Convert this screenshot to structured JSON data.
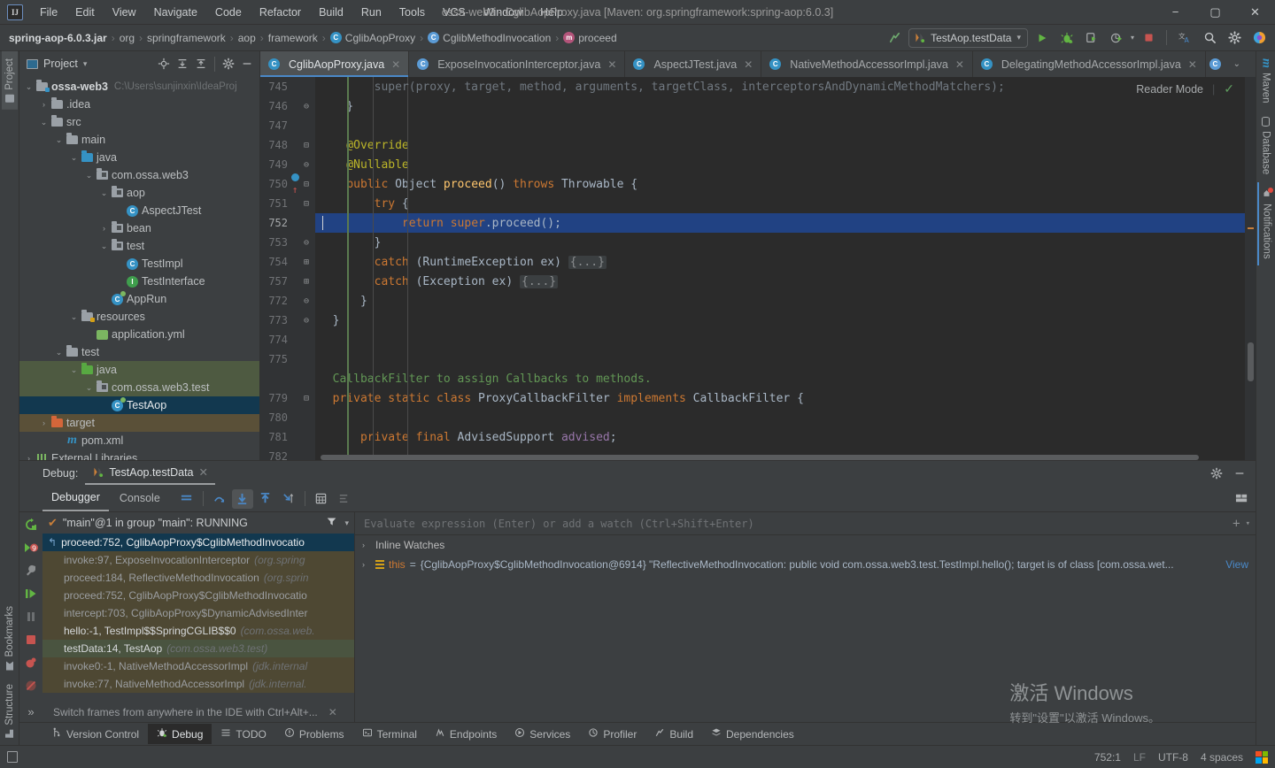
{
  "window": {
    "title": "ossa-web3 - CglibAopProxy.java [Maven: org.springframework:spring-aop:6.0.3]",
    "logo": "IJ",
    "minimize": "−",
    "maximize": "▢",
    "close": "✕"
  },
  "menubar": [
    "File",
    "Edit",
    "View",
    "Navigate",
    "Code",
    "Refactor",
    "Build",
    "Run",
    "Tools",
    "VCS",
    "Window",
    "Help"
  ],
  "breadcrumb": [
    {
      "label": "spring-aop-6.0.3.jar",
      "icon": "",
      "bold": true
    },
    {
      "label": "org",
      "icon": ""
    },
    {
      "label": "springframework",
      "icon": ""
    },
    {
      "label": "aop",
      "icon": ""
    },
    {
      "label": "framework",
      "icon": ""
    },
    {
      "label": "CglibAopProxy",
      "icon": "class-icon"
    },
    {
      "label": "CglibMethodInvocation",
      "icon": "class-icon"
    },
    {
      "label": "proceed",
      "icon": "method-icon"
    }
  ],
  "run_config": {
    "name": "TestAop.testData",
    "chevron": "▾"
  },
  "toolbar_icons": [
    "build-icon",
    "run-icon",
    "debug-icon",
    "run-with-coverage-icon",
    "profile-icon",
    "stop-icon",
    "translate-icon",
    "search-icon",
    "settings-icon",
    "ai-assistant-icon"
  ],
  "project_panel": {
    "title": "Project",
    "chevron": "▾",
    "actions": [
      "locate-icon",
      "expand-all-icon",
      "collapse-all-icon",
      "gear-icon",
      "hide-icon"
    ],
    "tree": [
      {
        "depth": 0,
        "twisty": "v",
        "icon": "module-folder",
        "label": "ossa-web3",
        "bold": true,
        "path": "C:\\Users\\sunjinxin\\IdeaProj",
        "state": ""
      },
      {
        "depth": 1,
        "twisty": ">",
        "icon": "folder",
        "label": ".idea",
        "state": ""
      },
      {
        "depth": 1,
        "twisty": "v",
        "icon": "folder",
        "label": "src",
        "state": ""
      },
      {
        "depth": 2,
        "twisty": "v",
        "icon": "folder",
        "label": "main",
        "state": ""
      },
      {
        "depth": 3,
        "twisty": "v",
        "icon": "folder-blue",
        "label": "java",
        "state": ""
      },
      {
        "depth": 4,
        "twisty": "v",
        "icon": "package",
        "label": "com.ossa.web3",
        "state": ""
      },
      {
        "depth": 5,
        "twisty": "v",
        "icon": "package",
        "label": "aop",
        "state": ""
      },
      {
        "depth": 6,
        "twisty": "",
        "icon": "class-c",
        "label": "AspectJTest",
        "state": ""
      },
      {
        "depth": 5,
        "twisty": ">",
        "icon": "package",
        "label": "bean",
        "state": ""
      },
      {
        "depth": 5,
        "twisty": "v",
        "icon": "package",
        "label": "test",
        "state": ""
      },
      {
        "depth": 6,
        "twisty": "",
        "icon": "class-c",
        "label": "TestImpl",
        "state": ""
      },
      {
        "depth": 6,
        "twisty": "",
        "icon": "interface-i",
        "label": "TestInterface",
        "state": ""
      },
      {
        "depth": 5,
        "twisty": "",
        "icon": "spring-class",
        "label": "AppRun",
        "state": ""
      },
      {
        "depth": 3,
        "twisty": "v",
        "icon": "folder-res",
        "label": "resources",
        "state": ""
      },
      {
        "depth": 4,
        "twisty": "",
        "icon": "yml",
        "label": "application.yml",
        "state": ""
      },
      {
        "depth": 2,
        "twisty": "v",
        "icon": "folder",
        "label": "test",
        "state": ""
      },
      {
        "depth": 3,
        "twisty": "v",
        "icon": "folder-green",
        "label": "java",
        "state": "sel-green"
      },
      {
        "depth": 4,
        "twisty": "v",
        "icon": "package",
        "label": "com.ossa.web3.test",
        "state": "sel-green"
      },
      {
        "depth": 5,
        "twisty": "",
        "icon": "spring-class",
        "label": "TestAop",
        "state": "sel-blue"
      },
      {
        "depth": 1,
        "twisty": ">",
        "icon": "folder-orange",
        "label": "target",
        "state": "sel-brown"
      },
      {
        "depth": 2,
        "twisty": "",
        "icon": "maven",
        "label": "pom.xml",
        "state": ""
      },
      {
        "depth": 0,
        "twisty": ">",
        "icon": "libraries",
        "label": "External Libraries",
        "state": ""
      }
    ]
  },
  "editor_tabs": [
    {
      "label": "CglibAopProxy.java",
      "icon": "class-icon",
      "active": true
    },
    {
      "label": "ExposeInvocationInterceptor.java",
      "icon": "class-icon",
      "active": false
    },
    {
      "label": "AspectJTest.java",
      "icon": "class-icon",
      "active": false
    },
    {
      "label": "NativeMethodAccessorImpl.java",
      "icon": "class-icon",
      "active": false
    },
    {
      "label": "DelegatingMethodAccessorImpl.java",
      "icon": "class-icon",
      "active": false
    }
  ],
  "editor_tabbar_actions": [
    "more-tabs-icon",
    "chevron-down-icon",
    "options-icon"
  ],
  "editor": {
    "reader_mode_label": "Reader Mode",
    "inspection_status": "✓",
    "caret_position": "752:1",
    "lines": [
      {
        "num": "745",
        "fold": "",
        "breakpoint": false,
        "current": false,
        "faded": true,
        "tokens": [
          {
            "t": "        super(proxy, target, method, arguments, targetClass, interceptorsAndDynamicMethodMatchers);",
            "c": "ty"
          }
        ]
      },
      {
        "num": "746",
        "fold": "⊖",
        "breakpoint": false,
        "current": false,
        "tokens": [
          {
            "t": "    }",
            "c": "ty"
          }
        ]
      },
      {
        "num": "747",
        "fold": "",
        "breakpoint": false,
        "current": false,
        "tokens": [
          {
            "t": "",
            "c": "ty"
          }
        ]
      },
      {
        "num": "748",
        "fold": "⊟",
        "breakpoint": false,
        "current": false,
        "tokens": [
          {
            "t": "    @Override",
            "c": "a"
          }
        ]
      },
      {
        "num": "749",
        "fold": "⊖",
        "breakpoint": false,
        "current": false,
        "tokens": [
          {
            "t": "    @Nullable",
            "c": "a"
          }
        ]
      },
      {
        "num": "750",
        "fold": "⊟",
        "breakpoint": true,
        "current": false,
        "tokens": [
          {
            "t": "    ",
            "c": "ty"
          },
          {
            "t": "public",
            "c": "k"
          },
          {
            "t": " Object ",
            "c": "ty"
          },
          {
            "t": "proceed",
            "c": "mth"
          },
          {
            "t": "() ",
            "c": "ty"
          },
          {
            "t": "throws",
            "c": "k"
          },
          {
            "t": " Throwable {",
            "c": "ty"
          }
        ]
      },
      {
        "num": "751",
        "fold": "⊟",
        "breakpoint": false,
        "current": false,
        "tokens": [
          {
            "t": "        ",
            "c": "ty"
          },
          {
            "t": "try",
            "c": "k"
          },
          {
            "t": " {",
            "c": "ty"
          }
        ]
      },
      {
        "num": "752",
        "fold": "",
        "breakpoint": false,
        "current": true,
        "tokens": [
          {
            "t": "            ",
            "c": "ty"
          },
          {
            "t": "return",
            "c": "k"
          },
          {
            "t": " ",
            "c": "ty"
          },
          {
            "t": "super",
            "c": "k"
          },
          {
            "t": ".proceed();",
            "c": "ty"
          }
        ]
      },
      {
        "num": "753",
        "fold": "⊖",
        "breakpoint": false,
        "current": false,
        "tokens": [
          {
            "t": "        }",
            "c": "ty"
          }
        ]
      },
      {
        "num": "754",
        "fold": "⊞",
        "breakpoint": false,
        "current": false,
        "tokens": [
          {
            "t": "        ",
            "c": "ty"
          },
          {
            "t": "catch",
            "c": "k"
          },
          {
            "t": " (RuntimeException ex) ",
            "c": "ty"
          },
          {
            "t": "{...}",
            "c": "fold"
          }
        ]
      },
      {
        "num": "757",
        "fold": "⊞",
        "breakpoint": false,
        "current": false,
        "tokens": [
          {
            "t": "        ",
            "c": "ty"
          },
          {
            "t": "catch",
            "c": "k"
          },
          {
            "t": " (Exception ex) ",
            "c": "ty"
          },
          {
            "t": "{...}",
            "c": "fold"
          }
        ]
      },
      {
        "num": "772",
        "fold": "⊖",
        "breakpoint": false,
        "current": false,
        "tokens": [
          {
            "t": "      }",
            "c": "ty"
          }
        ]
      },
      {
        "num": "773",
        "fold": "⊖",
        "breakpoint": false,
        "current": false,
        "tokens": [
          {
            "t": "  }",
            "c": "ty"
          }
        ]
      },
      {
        "num": "774",
        "fold": "",
        "breakpoint": false,
        "current": false,
        "tokens": [
          {
            "t": "",
            "c": "ty"
          }
        ]
      },
      {
        "num": "775",
        "fold": "",
        "breakpoint": false,
        "current": false,
        "tokens": [
          {
            "t": "",
            "c": "ty"
          }
        ]
      },
      {
        "num": "",
        "fold": "",
        "breakpoint": false,
        "current": false,
        "doc": true,
        "tokens": [
          {
            "t": "  CallbackFilter to assign Callbacks to methods.",
            "c": "cm"
          }
        ]
      },
      {
        "num": "779",
        "fold": "⊟",
        "breakpoint": false,
        "current": false,
        "tokens": [
          {
            "t": "  ",
            "c": "ty"
          },
          {
            "t": "private static class",
            "c": "k"
          },
          {
            "t": " ProxyCallbackFilter ",
            "c": "ty"
          },
          {
            "t": "implements",
            "c": "k"
          },
          {
            "t": " CallbackFilter {",
            "c": "ty"
          }
        ]
      },
      {
        "num": "780",
        "fold": "",
        "breakpoint": false,
        "current": false,
        "tokens": [
          {
            "t": "",
            "c": "ty"
          }
        ]
      },
      {
        "num": "781",
        "fold": "",
        "breakpoint": false,
        "current": false,
        "tokens": [
          {
            "t": "      ",
            "c": "ty"
          },
          {
            "t": "private final",
            "c": "k"
          },
          {
            "t": " AdvisedSupport ",
            "c": "ty"
          },
          {
            "t": "advised",
            "c": "f"
          },
          {
            "t": ";",
            "c": "ty"
          }
        ]
      },
      {
        "num": "782",
        "fold": "",
        "breakpoint": false,
        "current": false,
        "faded": true,
        "tokens": [
          {
            "t": "",
            "c": "ty"
          }
        ]
      }
    ]
  },
  "debug": {
    "title": "Debug:",
    "session_tab": "TestAop.testData",
    "session_close": "✕",
    "header_actions": [
      "gear-icon",
      "hide-icon"
    ],
    "tabs": [
      {
        "label": "Debugger",
        "active": true
      },
      {
        "label": "Console",
        "active": false
      }
    ],
    "toolbar_icons": [
      "layout-icon",
      "step-over-icon",
      "step-into-icon",
      "step-out-icon",
      "run-to-cursor-icon",
      "evaluate-icon",
      "mute-breakpoints-icon"
    ],
    "side_icons": [
      "rerun-icon",
      "breakpoints-icon",
      "settings-wrench-icon",
      "resume-icon",
      "pause-icon",
      "stop-icon",
      "view-breakpoints-icon",
      "mute-breakpoints-icon",
      "more-icon"
    ],
    "thread": {
      "label": "\"main\"@1 in group \"main\": RUNNING",
      "check": "✔",
      "filter_icon": "filter-icon",
      "chevron": "▾"
    },
    "frames": [
      {
        "text": "proceed:752, CglibAopProxy$CglibMethodInvocatio",
        "pkg": "",
        "state": "f-sel",
        "arrow": "↰"
      },
      {
        "text": "invoke:97, ExposeInvocationInterceptor ",
        "pkg": "(org.spring",
        "state": "f-lib"
      },
      {
        "text": "proceed:184, ReflectiveMethodInvocation ",
        "pkg": "(org.sprin",
        "state": "f-lib"
      },
      {
        "text": "proceed:752, CglibAopProxy$CglibMethodInvocatio",
        "pkg": "",
        "state": "f-lib"
      },
      {
        "text": "intercept:703, CglibAopProxy$DynamicAdvisedInter",
        "pkg": "",
        "state": "f-lib"
      },
      {
        "text": "hello:-1, TestImpl$$SpringCGLIB$$0 ",
        "pkg": "(com.ossa.web.",
        "state": "f-user2"
      },
      {
        "text": "testData:14, TestAop ",
        "pkg": "(com.ossa.web3.test)",
        "state": "f-user"
      },
      {
        "text": "invoke0:-1, NativeMethodAccessorImpl ",
        "pkg": "(jdk.internal",
        "state": "f-lib"
      },
      {
        "text": "invoke:77, NativeMethodAccessorImpl ",
        "pkg": "(jdk.internal.",
        "state": "f-lib"
      }
    ],
    "hint": {
      "text": "Switch frames from anywhere in the IDE with Ctrl+Alt+...",
      "close": "✕"
    },
    "evaluate_placeholder": "Evaluate expression (Enter) or add a watch (Ctrl+Shift+Enter)",
    "evaluate_actions": [
      "add-watch-icon",
      "chevron-down-icon"
    ],
    "variables": [
      {
        "arrow": "›",
        "icon": "",
        "name": "Inline Watches",
        "eq": "",
        "value": "",
        "link": ""
      },
      {
        "arrow": "›",
        "icon": "field-icon",
        "name": "this",
        "eq": " = ",
        "value": "{CglibAopProxy$CglibMethodInvocation@6914} \"ReflectiveMethodInvocation: public void com.ossa.web3.test.TestImpl.hello(); target is of class [com.ossa.wet...",
        "link": "View"
      }
    ]
  },
  "left_strip": {
    "top": [
      {
        "label": "Project",
        "icon": "project-icon",
        "active": true
      }
    ],
    "bottom": [
      {
        "label": "Bookmarks",
        "icon": "bookmark-icon"
      },
      {
        "label": "Structure",
        "icon": "structure-icon"
      }
    ]
  },
  "right_strip": {
    "top": [
      {
        "label": "Maven",
        "icon": "maven-icon"
      },
      {
        "label": "Database",
        "icon": "database-icon"
      },
      {
        "label": "Notifications",
        "icon": "notifications-icon",
        "badge": true
      }
    ]
  },
  "bottom_bar": [
    {
      "label": "Version Control",
      "icon": "branch-icon",
      "active": false
    },
    {
      "label": "Debug",
      "icon": "debug-icon",
      "active": true
    },
    {
      "label": "TODO",
      "icon": "todo-icon",
      "active": false
    },
    {
      "label": "Problems",
      "icon": "problems-icon",
      "active": false
    },
    {
      "label": "Terminal",
      "icon": "terminal-icon",
      "active": false
    },
    {
      "label": "Endpoints",
      "icon": "endpoints-icon",
      "active": false
    },
    {
      "label": "Services",
      "icon": "services-icon",
      "active": false
    },
    {
      "label": "Profiler",
      "icon": "profiler-icon",
      "active": false
    },
    {
      "label": "Build",
      "icon": "build-icon",
      "active": false
    },
    {
      "label": "Dependencies",
      "icon": "dependencies-icon",
      "active": false
    }
  ],
  "status_bar": {
    "left_icon": "memory-icon",
    "caret": "752:1",
    "line_sep": "LF",
    "encoding": "UTF-8",
    "indent": "4 spaces",
    "os_logo": "windows-logo"
  },
  "watermark": {
    "line1": "激活 Windows",
    "line2": "转到\"设置\"以激活 Windows。"
  },
  "colors": {
    "accent_blue": "#4a88c7",
    "selection_blue": "#214283",
    "panel_bg": "#3c3f41",
    "editor_bg": "#2b2b2b",
    "keyword_orange": "#cc7832",
    "string_green": "#6a8759",
    "annotation_yellow": "#bbb529",
    "comment_green": "#629755"
  }
}
